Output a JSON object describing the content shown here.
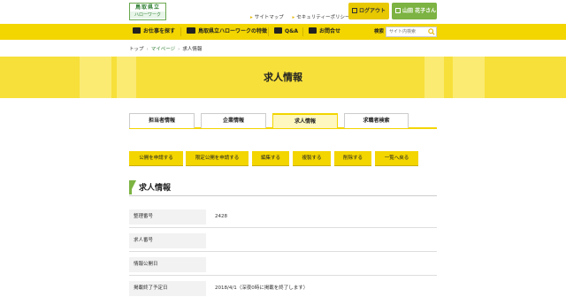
{
  "header": {
    "logo_line1": "鳥取県立",
    "logo_line2": "ハローワーク",
    "links": [
      "サイトマップ",
      "セキュリティーポリシー"
    ],
    "logout_label": "ログアウト",
    "user_label": "山田 花子さん"
  },
  "nav": {
    "items": [
      {
        "label": "お仕事を探す",
        "icon": "briefcase-icon"
      },
      {
        "label": "鳥取県立ハローワークの特徴",
        "icon": "handshake-icon"
      },
      {
        "label": "Q&A",
        "icon": "chat-icon"
      },
      {
        "label": "お問合せ",
        "icon": "mail-icon"
      }
    ],
    "search_label": "検索",
    "search_placeholder": "サイト内検索"
  },
  "breadcrumb": [
    "トップ",
    "マイページ",
    "求人情報"
  ],
  "hero": {
    "title": "求人情報"
  },
  "tabs": [
    {
      "label": "担当者情報",
      "active": false
    },
    {
      "label": "企業情報",
      "active": false
    },
    {
      "label": "求人情報",
      "active": true
    },
    {
      "label": "求職者検索",
      "active": false
    }
  ],
  "actions": [
    "公開を申請する",
    "限定公開を申請する",
    "編集する",
    "複製する",
    "削除する",
    "一覧へ戻る"
  ],
  "section": {
    "title": "求人情報"
  },
  "rows": [
    {
      "label": "整理番号",
      "value": "2428"
    },
    {
      "label": "求人番号",
      "value": ""
    },
    {
      "label": "情報公開日",
      "value": ""
    },
    {
      "label": "掲載終了予定日",
      "value": "2018/4/1（深夜0時に掲載を終了します）"
    }
  ],
  "colors": {
    "accent": "#f3d500",
    "green": "#7cb342"
  }
}
